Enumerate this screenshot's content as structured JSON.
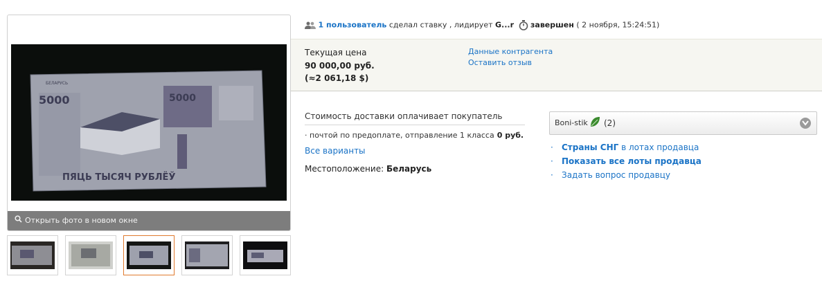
{
  "photo": {
    "open_label": "Открыть фото в новом окне",
    "banknote": {
      "top_text": "БЕЛАРУСЬ",
      "value": "5000",
      "value_right": "5000",
      "bottom_text": "ПЯЦЬ ТЫСЯЧ РУБЛЁЎ"
    },
    "thumbnails_count": 5,
    "active_thumbnail": 3
  },
  "status": {
    "users_link": "1 пользователь",
    "bid_text": "сделал ставку , лидирует",
    "leader": "G...r",
    "state": "завершен",
    "end_time": "( 2 ноября, 15:24:51)"
  },
  "price": {
    "label": "Текущая цена",
    "value": "90 000,00 руб.",
    "approx": "(≈2 061,18 $)",
    "counterparty_link": "Данные контрагента",
    "review_link": "Оставить отзыв"
  },
  "delivery": {
    "title": "Стоимость доставки оплачивает покупатель",
    "method": "почтой по предоплате, отправление 1 класса",
    "method_price": "0 руб.",
    "all_variants": "Все варианты",
    "location_label": "Местоположение:",
    "location_value": "Беларусь"
  },
  "seller": {
    "name": "Boni-stik",
    "rating": "(2)",
    "links": {
      "cis_bold": "Страны СНГ",
      "cis_rest": "в лотах продавца",
      "all_lots": "Показать все лоты продавца",
      "ask": "Задать вопрос продавцу"
    }
  },
  "colors": {
    "link": "#1a73c6",
    "accent_border": "#e07a2e",
    "leaf": "#3a8a2e"
  }
}
